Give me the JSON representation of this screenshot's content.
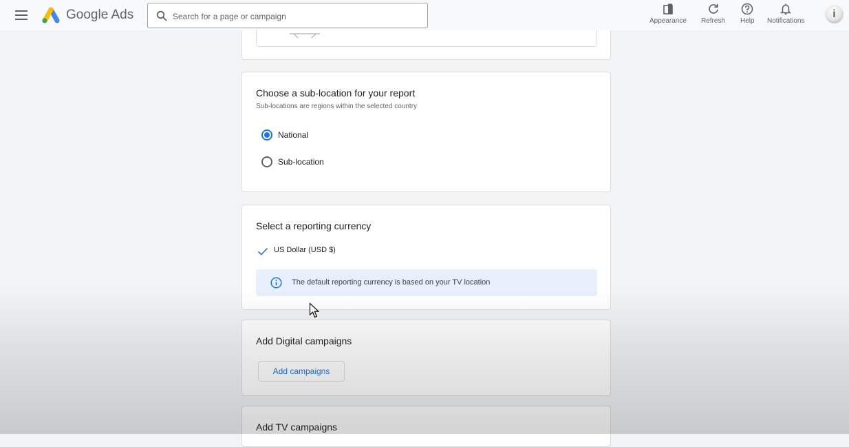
{
  "header": {
    "brand": "Google Ads",
    "search_placeholder": "Search for a page or campaign",
    "tools": [
      {
        "label": "Appearance",
        "icon": "appearance-icon"
      },
      {
        "label": "Refresh",
        "icon": "refresh-icon"
      },
      {
        "label": "Help",
        "icon": "help-icon"
      },
      {
        "label": "Notifications",
        "icon": "bell-icon"
      }
    ],
    "avatar_icon": "info-icon"
  },
  "sublocation": {
    "title": "Choose a sub-location for your report",
    "subtitle": "Sub-locations are regions within the selected country",
    "options": [
      {
        "label": "National",
        "selected": true
      },
      {
        "label": "Sub-location",
        "selected": false
      }
    ]
  },
  "currency": {
    "title": "Select a reporting currency",
    "selected": "US Dollar (USD $)",
    "info": "The default reporting currency is based on your TV location"
  },
  "digital": {
    "title": "Add Digital campaigns",
    "button_label": "Add campaigns"
  },
  "tv": {
    "title": "Add TV campaigns"
  },
  "colors": {
    "accent": "#1a73e8",
    "info_bg": "#e8f0fe",
    "background": "#f1f3f4"
  }
}
